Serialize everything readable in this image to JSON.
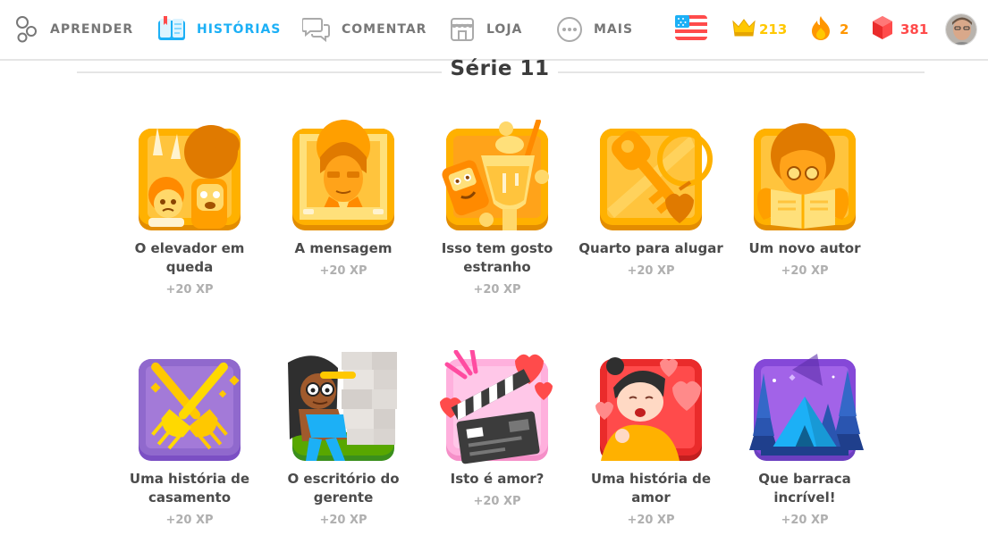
{
  "nav": {
    "learn": {
      "label": "APRENDER",
      "icon": "learn-icon"
    },
    "stories": {
      "label": "HISTÓRIAS",
      "icon": "book-icon"
    },
    "discuss": {
      "label": "COMENTAR",
      "icon": "chat-bubbles-icon"
    },
    "shop": {
      "label": "LOJA",
      "icon": "shop-icon"
    },
    "more": {
      "label": "MAIS",
      "icon": "more-icon"
    }
  },
  "stats": {
    "language_flag": "us-flag-icon",
    "crowns": "213",
    "streak": "2",
    "gems": "381"
  },
  "colors": {
    "accent": "#1cb0f6",
    "crown": "#ffc800",
    "streak": "#ff9600",
    "gems": "#ff4b4b",
    "muted": "#afafaf"
  },
  "series": {
    "title": "Série 11"
  },
  "stories": [
    {
      "title": "O elevador em queda",
      "xp": "+20 XP",
      "icon": "elevator-story-icon"
    },
    {
      "title": "A mensagem",
      "xp": "+20 XP",
      "icon": "message-story-icon"
    },
    {
      "title": "Isso tem gosto estranho",
      "xp": "+20 XP",
      "icon": "drink-story-icon"
    },
    {
      "title": "Quarto para alugar",
      "xp": "+20 XP",
      "icon": "key-story-icon"
    },
    {
      "title": "Um novo autor",
      "xp": "+20 XP",
      "icon": "book-reader-story-icon"
    },
    {
      "title": "Uma história de casamento",
      "xp": "+20 XP",
      "icon": "forks-story-icon"
    },
    {
      "title": "O escritório do gerente",
      "xp": "+20 XP",
      "icon": "boxes-story-icon"
    },
    {
      "title": "Isto é amor?",
      "xp": "+20 XP",
      "icon": "clapperboard-story-icon"
    },
    {
      "title": "Uma história de amor",
      "xp": "+20 XP",
      "icon": "love-story-icon"
    },
    {
      "title": "Que barraca incrível!",
      "xp": "+20 XP",
      "icon": "tent-story-icon"
    }
  ]
}
